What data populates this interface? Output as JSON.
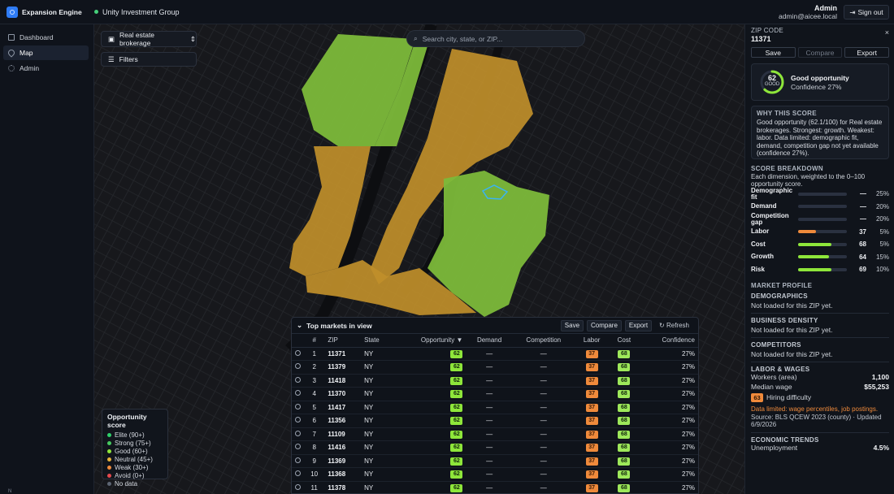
{
  "brand": {
    "name": "Expansion Engine"
  },
  "org": {
    "name": "Unity Investment Group"
  },
  "user": {
    "name": "Admin",
    "email": "admin@aicee.local",
    "signout": "Sign out"
  },
  "nav": [
    {
      "label": "Dashboard",
      "icon": "grid-icon"
    },
    {
      "label": "Map",
      "icon": "map-pin-icon"
    },
    {
      "label": "Admin",
      "icon": "gear-icon"
    }
  ],
  "sidebar_footer": "N",
  "map": {
    "industry": "Real estate brokerage",
    "filters": "Filters",
    "search_placeholder": "Search city, state, or ZIP..."
  },
  "legend": {
    "title": "Opportunity score",
    "items": [
      {
        "label": "Elite (90+)",
        "color": "#2fd06a"
      },
      {
        "label": "Strong (75+)",
        "color": "#46c95f"
      },
      {
        "label": "Good (60+)",
        "color": "#8ee63a"
      },
      {
        "label": "Neutral (45+)",
        "color": "#e6b23a"
      },
      {
        "label": "Weak (30+)",
        "color": "#ef8a3b"
      },
      {
        "label": "Avoid (0+)",
        "color": "#e5484d"
      },
      {
        "label": "No data",
        "color": "#5d6573"
      }
    ]
  },
  "markets": {
    "title": "Top markets in view",
    "save": "Save",
    "compare": "Compare",
    "export": "Export",
    "refresh": "Refresh",
    "columns": [
      "#",
      "ZIP",
      "State",
      "Opportunity ▼",
      "Demand",
      "Competition",
      "Labor",
      "Cost",
      "Confidence"
    ],
    "rows": [
      {
        "rank": "1",
        "zip": "11371",
        "state": "NY",
        "opportunity": "62",
        "demand": "—",
        "competition": "—",
        "labor": "37",
        "cost": "68",
        "confidence": "27%"
      },
      {
        "rank": "2",
        "zip": "11379",
        "state": "NY",
        "opportunity": "62",
        "demand": "—",
        "competition": "—",
        "labor": "37",
        "cost": "68",
        "confidence": "27%"
      },
      {
        "rank": "3",
        "zip": "11418",
        "state": "NY",
        "opportunity": "62",
        "demand": "—",
        "competition": "—",
        "labor": "37",
        "cost": "68",
        "confidence": "27%"
      },
      {
        "rank": "4",
        "zip": "11370",
        "state": "NY",
        "opportunity": "62",
        "demand": "—",
        "competition": "—",
        "labor": "37",
        "cost": "68",
        "confidence": "27%"
      },
      {
        "rank": "5",
        "zip": "11417",
        "state": "NY",
        "opportunity": "62",
        "demand": "—",
        "competition": "—",
        "labor": "37",
        "cost": "68",
        "confidence": "27%"
      },
      {
        "rank": "6",
        "zip": "11356",
        "state": "NY",
        "opportunity": "62",
        "demand": "—",
        "competition": "—",
        "labor": "37",
        "cost": "68",
        "confidence": "27%"
      },
      {
        "rank": "7",
        "zip": "11109",
        "state": "NY",
        "opportunity": "62",
        "demand": "—",
        "competition": "—",
        "labor": "37",
        "cost": "68",
        "confidence": "27%"
      },
      {
        "rank": "8",
        "zip": "11416",
        "state": "NY",
        "opportunity": "62",
        "demand": "—",
        "competition": "—",
        "labor": "37",
        "cost": "68",
        "confidence": "27%"
      },
      {
        "rank": "9",
        "zip": "11369",
        "state": "NY",
        "opportunity": "62",
        "demand": "—",
        "competition": "—",
        "labor": "37",
        "cost": "68",
        "confidence": "27%"
      },
      {
        "rank": "10",
        "zip": "11368",
        "state": "NY",
        "opportunity": "62",
        "demand": "—",
        "competition": "—",
        "labor": "37",
        "cost": "68",
        "confidence": "27%"
      },
      {
        "rank": "11",
        "zip": "11378",
        "state": "NY",
        "opportunity": "62",
        "demand": "—",
        "competition": "—",
        "labor": "37",
        "cost": "68",
        "confidence": "27%"
      }
    ]
  },
  "panel": {
    "label": "ZIP CODE",
    "zip": "11371",
    "close": "×",
    "save": "Save",
    "compare": "Compare",
    "export": "Export",
    "score": {
      "value": 62,
      "ring_label": "GOOD",
      "title": "Good opportunity",
      "confidence": "Confidence 27%"
    },
    "why_title": "WHY THIS SCORE",
    "why_text": "Good opportunity (62.1/100) for Real estate brokerages. Strongest: growth. Weakest: labor. Data limited: demographic fit, demand, competition gap not yet available (confidence 27%).",
    "breakdown_title": "SCORE BREAKDOWN",
    "breakdown_sub": "Each dimension, weighted to the 0–100 opportunity score.",
    "breakdown": [
      {
        "name": "Demographic fit",
        "value": "—",
        "weight": "25%",
        "level": 0,
        "color": "#8ee63a"
      },
      {
        "name": "Demand",
        "value": "—",
        "weight": "20%",
        "level": 0,
        "color": "#8ee63a"
      },
      {
        "name": "Competition gap",
        "value": "—",
        "weight": "20%",
        "level": 0,
        "color": "#8ee63a"
      },
      {
        "name": "Labor",
        "value": "37",
        "weight": "5%",
        "level": 37,
        "color": "#ef8a3b"
      },
      {
        "name": "Cost",
        "value": "68",
        "weight": "5%",
        "level": 68,
        "color": "#8ee63a"
      },
      {
        "name": "Growth",
        "value": "64",
        "weight": "15%",
        "level": 64,
        "color": "#8ee63a"
      },
      {
        "name": "Risk",
        "value": "69",
        "weight": "10%",
        "level": 69,
        "color": "#8ee63a"
      }
    ],
    "market_profile": "MARKET PROFILE",
    "demographics": {
      "title": "DEMOGRAPHICS",
      "note": "Not loaded for this ZIP yet."
    },
    "business_density": {
      "title": "BUSINESS DENSITY",
      "note": "Not loaded for this ZIP yet."
    },
    "competitors": {
      "title": "COMPETITORS",
      "note": "Not loaded for this ZIP yet."
    },
    "labor": {
      "title": "LABOR & WAGES",
      "workers_label": "Workers (area)",
      "workers": "1,100",
      "wage_label": "Median wage",
      "wage": "$55,253",
      "hiring_badge": "63",
      "hiring_label": "Hiring difficulty",
      "limited": "Data limited: wage percentiles, job postings.",
      "source": "Source: BLS QCEW 2023 (county) · Updated 6/9/2026"
    },
    "economic": {
      "title": "ECONOMIC TRENDS",
      "unemployment_label": "Unemployment",
      "unemployment": "4.5%"
    }
  },
  "colors": {
    "good": "#8ee63a",
    "neutral": "#c8962a",
    "weak": "#ef8a3b",
    "selected": "#3ab4f2"
  }
}
